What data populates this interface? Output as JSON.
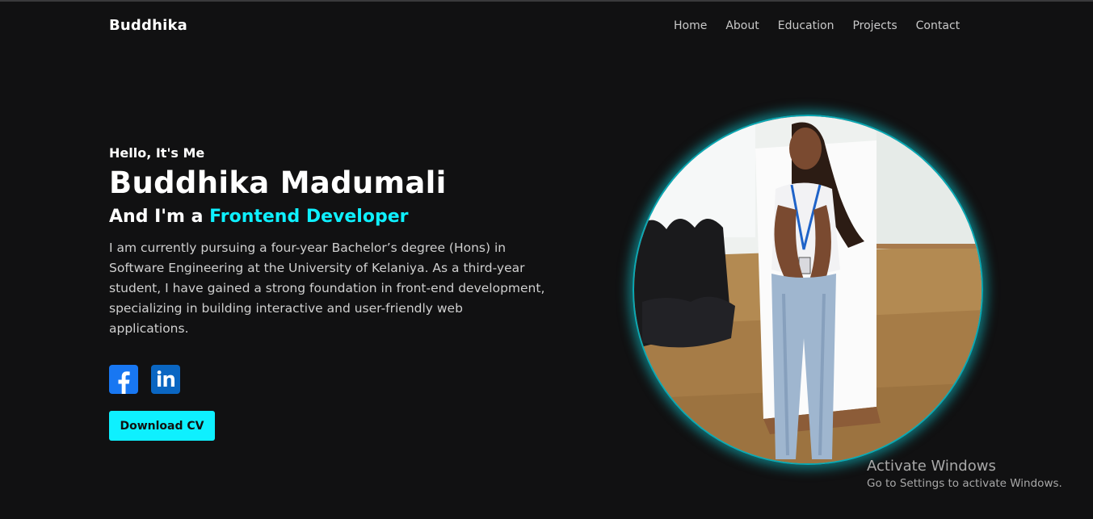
{
  "nav": {
    "logo": "Buddhika",
    "links": [
      "Home",
      "About",
      "Education",
      "Projects",
      "Contact"
    ]
  },
  "hero": {
    "greeting": "Hello, It's Me",
    "name": "Buddhika Madumali",
    "role_prefix": "And I'm a ",
    "role_highlight": "Frontend Developer",
    "bio": "I am currently pursuing a four-year Bachelor’s degree (Hons) in Software Engineering at the University of Kelaniya. As a third-year student, I have gained a strong foundation in front-end development, specializing in building interactive and user-friendly web applications.",
    "cta_label": "Download CV"
  },
  "social": [
    {
      "name": "facebook-icon",
      "glyph": "f"
    },
    {
      "name": "linkedin-icon",
      "glyph": "in"
    }
  ],
  "watermark": {
    "title": "Activate Windows",
    "subtitle": "Go to Settings to activate Windows."
  },
  "colors": {
    "background": "#111112",
    "accent": "#0ef0ff",
    "facebook": "#1877f2",
    "linkedin": "#0a66c2"
  }
}
